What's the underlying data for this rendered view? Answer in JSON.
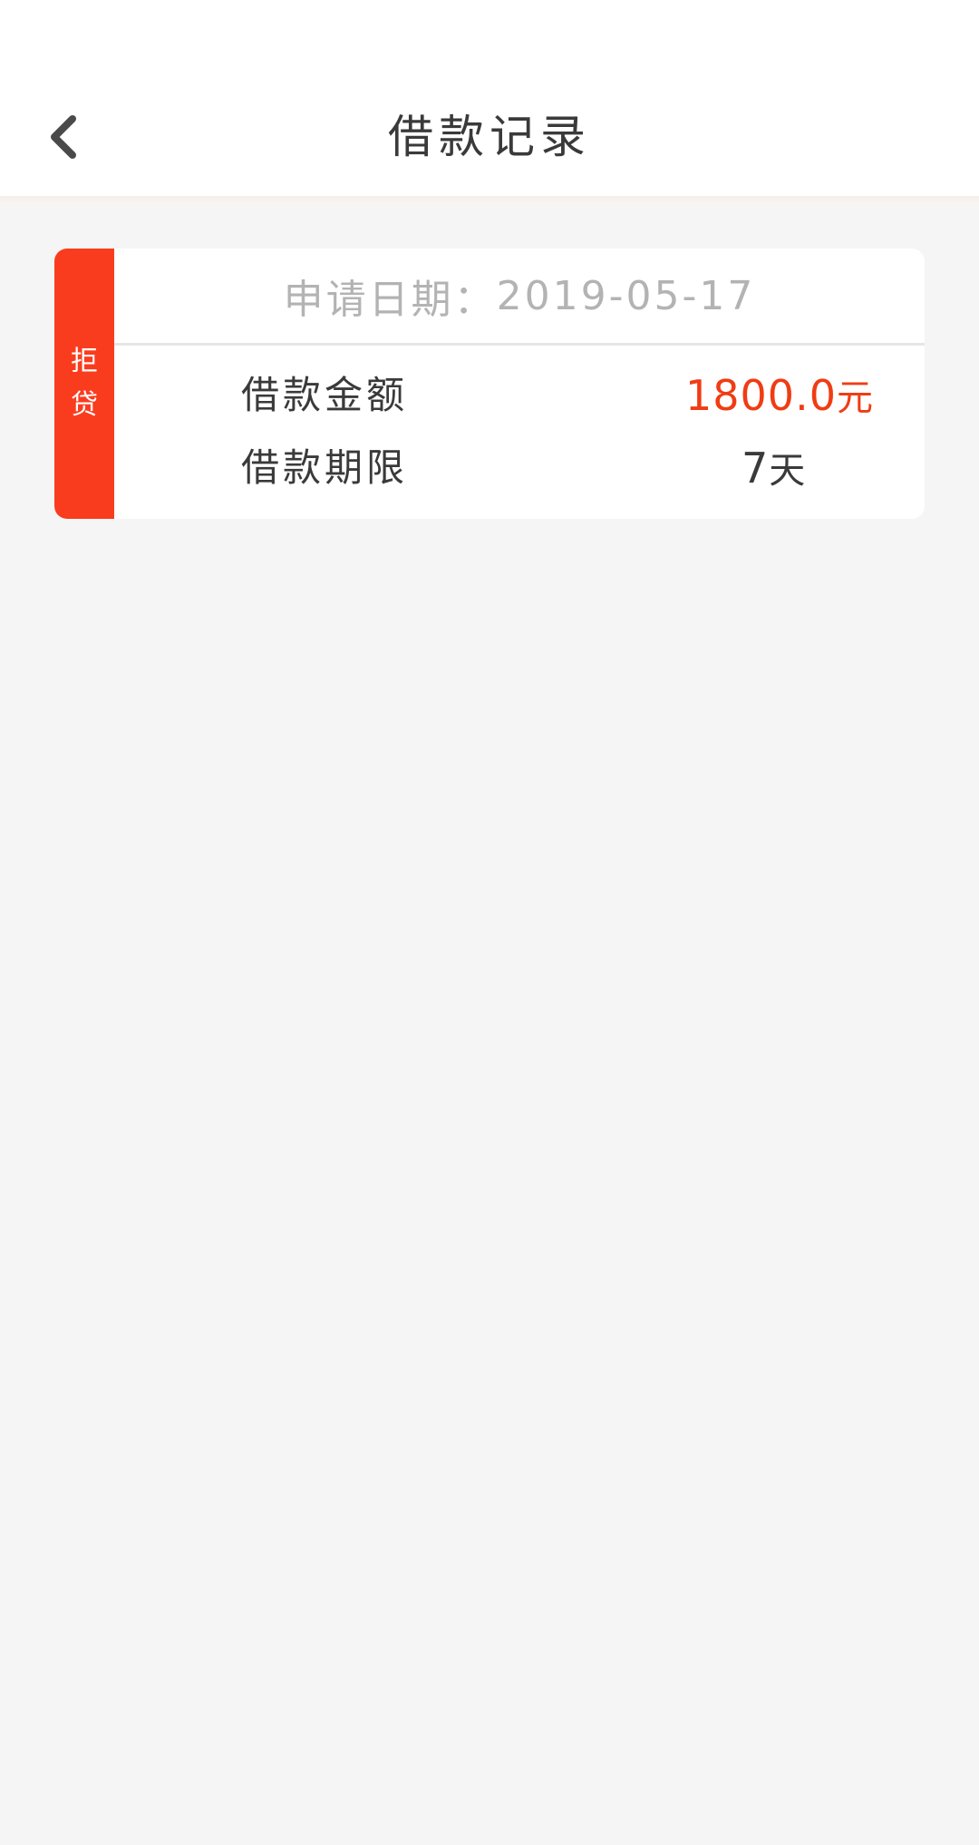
{
  "header": {
    "title": "借款记录",
    "back_icon": "chevron-left-icon"
  },
  "records": [
    {
      "status": "拒贷",
      "status_color": "#fa3c1e",
      "date_label": "申请日期：",
      "date_value": "2019-05-17",
      "amount_label": "借款金额",
      "amount_value": "1800.0",
      "amount_unit": "元",
      "amount_color": "#f03c14",
      "term_label": "借款期限",
      "term_value": "7",
      "term_unit": "天"
    }
  ]
}
